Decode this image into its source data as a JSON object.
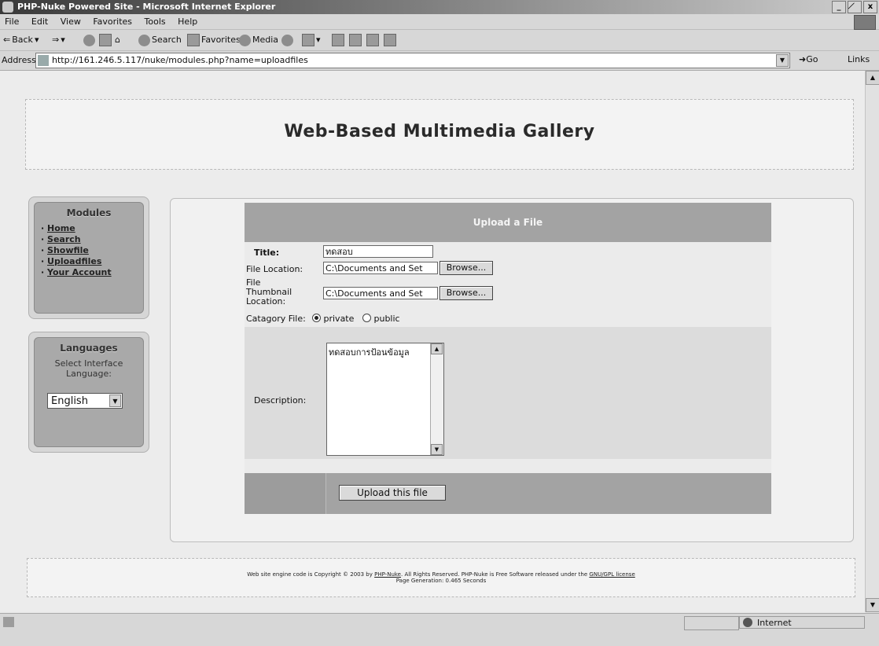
{
  "window": {
    "title": "PHP-Nuke Powered Site - Microsoft Internet Explorer",
    "controls": [
      "_",
      "̸",
      "x"
    ]
  },
  "menu": [
    "File",
    "Edit",
    "View",
    "Favorites",
    "Tools",
    "Help"
  ],
  "toolbar": {
    "back": "Back",
    "search": "Search",
    "favorites": "Favorites",
    "media": "Media"
  },
  "address": {
    "label": "Address",
    "url": "http://161.246.5.117/nuke/modules.php?name=uploadfiles",
    "go": "Go",
    "links": "Links"
  },
  "site": {
    "title": "Web-Based Multimedia Gallery"
  },
  "modules": {
    "title": "Modules",
    "items": [
      "Home",
      "Search",
      "Showfile",
      "Uploadfiles",
      "Your Account"
    ]
  },
  "languages": {
    "title": "Languages",
    "prompt": "Select Interface Language:",
    "selected": "English"
  },
  "upload": {
    "header": "Upload a File",
    "title_label": "Title:",
    "title_value": "ทดสอบ",
    "file_location_label": "File Location:",
    "file_location_value": "C:\\Documents and Set",
    "thumb_label_1": "File",
    "thumb_label_2": "Thumbnail",
    "thumb_label_3": "Location:",
    "thumb_value": "C:\\Documents and Set",
    "browse": "Browse...",
    "category_label": "Catagory File:",
    "category_private": "private",
    "category_public": "public",
    "category_selected": "private",
    "description_label": "Description:",
    "description_value": "ทดสอบการป้อนข้อมูล",
    "submit": "Upload this file"
  },
  "footer": {
    "line1_pre": "Web site engine code is Copyright © 2003 by",
    "line1_link": "PHP-Nuke",
    "line1_mid": ". All Rights Reserved. PHP-Nuke is Free Software released under the",
    "line1_license": "GNU/GPL license",
    "line2": "Page Generation: 0.465 Seconds"
  },
  "status": {
    "zone": "Internet"
  }
}
